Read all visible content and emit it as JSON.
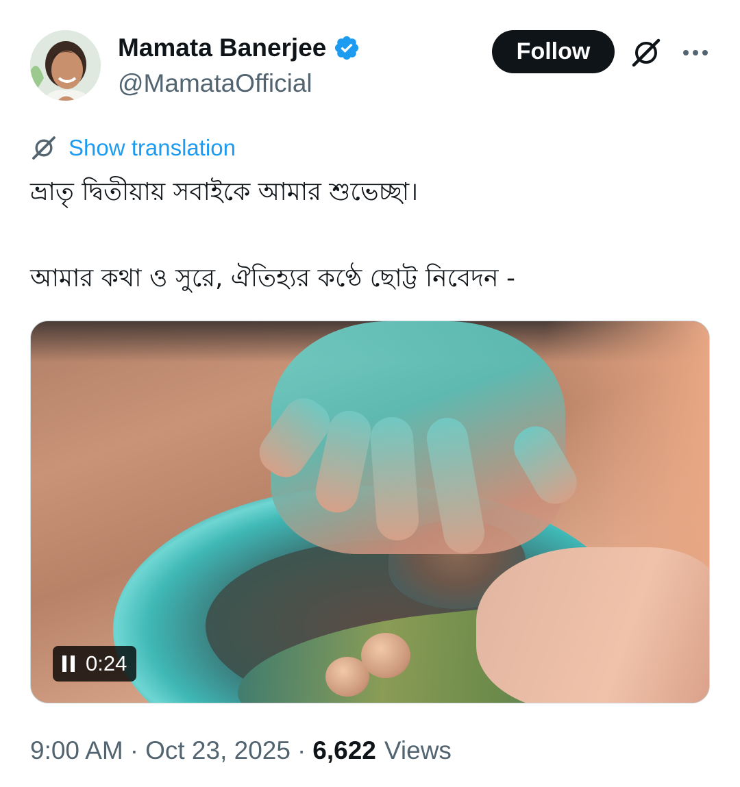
{
  "author": {
    "name": "Mamata Banerjee",
    "handle": "@MamataOfficial",
    "verified": true
  },
  "header": {
    "follow_label": "Follow",
    "grok_icon": "grok-icon",
    "more_icon": "more-icon"
  },
  "translation": {
    "label": "Show translation",
    "icon": "grok-icon"
  },
  "tweet": {
    "lines": [
      "ভ্রাতৃ দ্বিতীয়ায় সবাইকে আমার শুভেচ্ছা।",
      "আমার কথা ও সুরে, ঐতিহ্যর কণ্ঠে ছোট্ট নিবেদন -"
    ]
  },
  "media": {
    "type": "video",
    "playing": true,
    "time": "0:24"
  },
  "meta": {
    "time": "9:00 AM",
    "separator": "·",
    "date": "Oct 23, 2025",
    "views_count": "6,622",
    "views_label": "Views"
  },
  "colors": {
    "text_primary": "#0f1419",
    "text_secondary": "#536471",
    "link": "#1d9bf0",
    "verified": "#1d9bf0",
    "follow_bg": "#0f1419"
  }
}
